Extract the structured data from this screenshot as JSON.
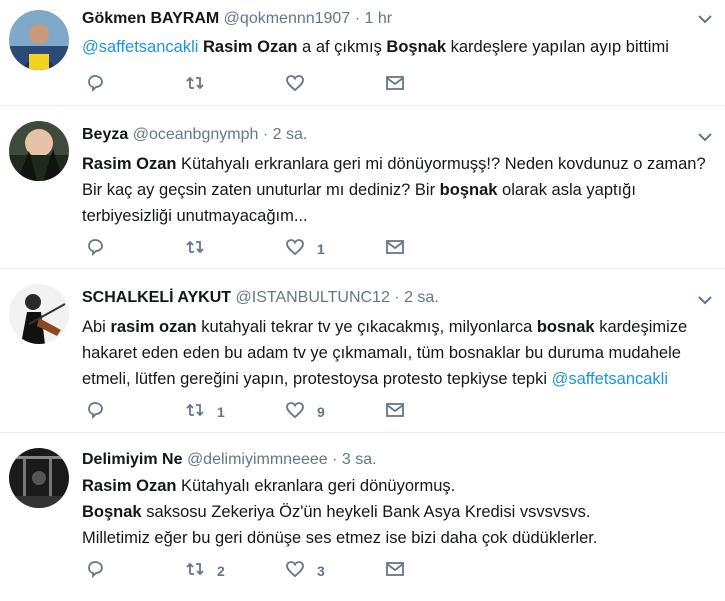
{
  "tweets": [
    {
      "name": "Gökmen BAYRAM",
      "handle": "@qokmennn1907",
      "sep": "·",
      "time": "1 hr",
      "text": [
        {
          "link": "@saffetsancakli"
        },
        {
          "t": " "
        },
        {
          "b": "Rasim Ozan"
        },
        {
          "t": " a af çıkmış "
        },
        {
          "b": "Boşnak"
        },
        {
          "t": " kardeşlere yapılan ayıp bittimi"
        }
      ],
      "reply_count": "",
      "retweet_count": "",
      "like_count": ""
    },
    {
      "name": "Beyza",
      "handle": "@oceanbgnymph",
      "sep": "·",
      "time": "2 sa.",
      "text": [
        {
          "b": "Rasim Ozan"
        },
        {
          "t": " Kütahyalı erkranlara geri mi dönüyormuşş!? Neden kovdunuz o zaman? Bir kaç ay geçsin zaten unuturlar mı dediniz? Bir "
        },
        {
          "b": "boşnak"
        },
        {
          "t": " olarak asla yaptığı terbiyesizliği unutmayacağım..."
        }
      ],
      "reply_count": "",
      "retweet_count": "",
      "like_count": "1"
    },
    {
      "name": "SCHALKELİ AYKUT",
      "handle": "@ISTANBULTUNC12",
      "sep": "·",
      "time": "2 sa.",
      "text": [
        {
          "t": "Abi "
        },
        {
          "b": "rasim ozan"
        },
        {
          "t": " kutahyali tekrar tv ye çıkacakmış, milyonlarca "
        },
        {
          "b": "bosnak"
        },
        {
          "t": " kardeşimize hakaret eden eden bu adam tv ye çıkmamalı, tüm bosnaklar bu duruma mudahele etmeli, lütfen gereğini yapın, protestoysa protesto tepkiyse tepki "
        },
        {
          "link": "@saffetsancakli"
        }
      ],
      "reply_count": "",
      "retweet_count": "1",
      "like_count": "9"
    },
    {
      "name": "Delimiyim Ne",
      "handle": "@delimiyimmneeee",
      "sep": "·",
      "time": "3 sa.",
      "text": [
        {
          "b": "Rasim Ozan"
        },
        {
          "t": " Kütahyalı ekranlara geri dönüyormuş."
        },
        {
          "br": true
        },
        {
          "b": "Boşnak"
        },
        {
          "t": " saksosu Zekeriya Öz'ün heykeli Bank Asya Kredisi vsvsvsvs."
        },
        {
          "br": true
        },
        {
          "t": "Milletimiz eğer bu geri dönüşe ses etmez ise bizi daha çok düdüklerler."
        }
      ],
      "reply_count": "",
      "retweet_count": "2",
      "like_count": "3"
    }
  ]
}
